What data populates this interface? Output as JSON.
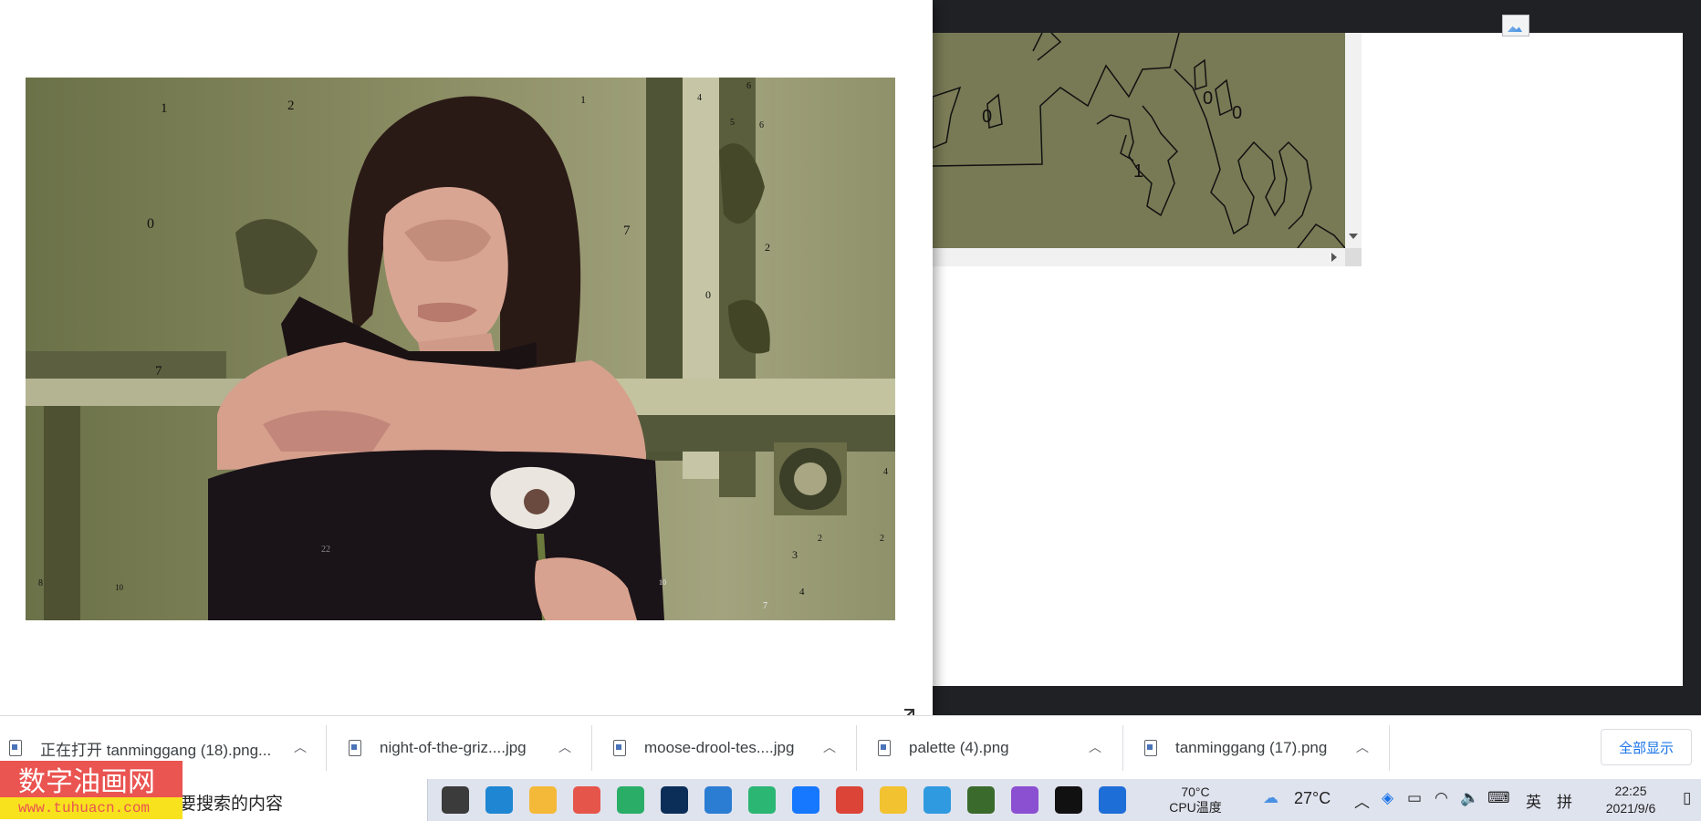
{
  "canvas_view": {
    "labels": [
      "0",
      "0",
      "0",
      "1"
    ]
  },
  "viewer": {
    "photo_labels": [
      "1",
      "2",
      "1",
      "6",
      "4",
      "5",
      "6",
      "0",
      "7",
      "2",
      "0",
      "7",
      "8",
      "3",
      "4",
      "7",
      "22",
      "10",
      "2",
      "2",
      "4",
      "10"
    ]
  },
  "downloads": {
    "items": [
      {
        "label": "正在打开 tanminggang (18).png..."
      },
      {
        "label": "night-of-the-griz....jpg"
      },
      {
        "label": "moose-drool-tes....jpg"
      },
      {
        "label": "palette (4).png"
      },
      {
        "label": "tanminggang (17).png"
      }
    ],
    "show_all": "全部显示"
  },
  "taskbar": {
    "search_placeholder": "要搜索的内容",
    "watermark_title": "数字油画网",
    "watermark_url": "www.tuhuacn.com",
    "cpu_temp": "70°C",
    "cpu_label": "CPU温度",
    "weather": "27°C",
    "ime_lang": "英",
    "ime_mode": "拼",
    "time": "22:25",
    "date": "2021/9/6",
    "apps": [
      {
        "icon": "task-view-icon",
        "color": "#3b3b3b"
      },
      {
        "icon": "edge-icon",
        "color": "#1e86d2"
      },
      {
        "icon": "file-explorer-icon",
        "color": "#f4b938"
      },
      {
        "icon": "colorful-app-icon",
        "color": "#e6554a"
      },
      {
        "icon": "wechat-icon",
        "color": "#2aae67"
      },
      {
        "icon": "photoshop-icon",
        "color": "#0a2e58"
      },
      {
        "icon": "word-icon",
        "color": "#2b7cd3"
      },
      {
        "icon": "wps-icon",
        "color": "#2bb673"
      },
      {
        "icon": "feishu-icon",
        "color": "#1677ff"
      },
      {
        "icon": "chrome-icon",
        "color": "#db4437"
      },
      {
        "icon": "yellow-app-icon",
        "color": "#f2c230"
      },
      {
        "icon": "browser-q-icon",
        "color": "#2f9ae0"
      },
      {
        "icon": "calculator-icon",
        "color": "#3a6b2c"
      },
      {
        "icon": "purple-app-icon",
        "color": "#8b4fd1"
      },
      {
        "icon": "record-icon",
        "color": "#111111"
      },
      {
        "icon": "photos-icon",
        "color": "#1e6ed8"
      }
    ]
  }
}
